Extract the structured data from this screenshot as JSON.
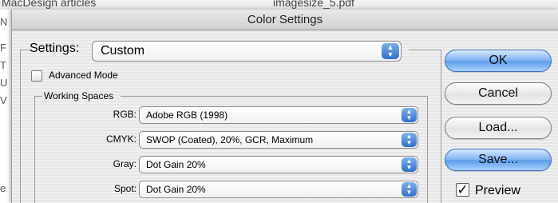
{
  "background": {
    "top_left_text": "MacDesign articles",
    "top_mid_text": "imagesize_5.pdf",
    "left_edge_glyphs": [
      "N",
      "F",
      "T",
      "U",
      "V",
      "e"
    ]
  },
  "dialog": {
    "title": "Color Settings",
    "settings": {
      "label": "Settings:",
      "value": "Custom"
    },
    "advanced_mode": {
      "label": "Advanced Mode",
      "checked": false
    },
    "working_spaces": {
      "legend": "Working Spaces",
      "rows": [
        {
          "label": "RGB:",
          "value": "Adobe RGB (1998)"
        },
        {
          "label": "CMYK:",
          "value": "SWOP (Coated), 20%, GCR, Maximum"
        },
        {
          "label": "Gray:",
          "value": "Dot Gain 20%"
        },
        {
          "label": "Spot:",
          "value": "Dot Gain 20%"
        }
      ]
    },
    "buttons": {
      "ok": "OK",
      "cancel": "Cancel",
      "load": "Load...",
      "save": "Save..."
    },
    "preview": {
      "label": "Preview",
      "checked": true
    },
    "icons": {
      "stepper": "up-down-arrows-icon",
      "checkmark": "checkmark-icon"
    },
    "colors": {
      "accent_blue": "#5b9ce9",
      "stepper_blue": "#2f6fc9"
    }
  }
}
